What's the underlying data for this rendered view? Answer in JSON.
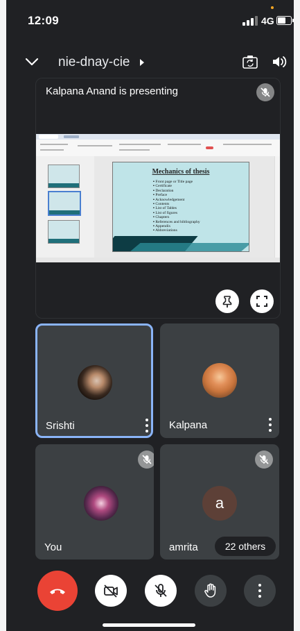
{
  "status_bar": {
    "time": "12:09",
    "network": "4G"
  },
  "top_bar": {
    "meeting_name": "nie-dnay-cie"
  },
  "presentation": {
    "label": "Kalpana Anand is presenting",
    "slide": {
      "title": "Mechanics of thesis",
      "bullets": [
        "Front page or Title page",
        "Certificate",
        "Declaration",
        "Preface",
        "Acknowledgement",
        "Contents",
        "List of Tables",
        "List of figures",
        "Chapters",
        "References and bibliography",
        "Appendix",
        "Abbreviations"
      ]
    }
  },
  "participants": [
    {
      "name": "Srishti",
      "muted": false,
      "active_speaker": true
    },
    {
      "name": "Kalpana",
      "muted": false
    },
    {
      "name": "You",
      "muted": true
    },
    {
      "name": "amrita",
      "muted": true,
      "avatar_letter": "a",
      "avatar_color": "#5d4037"
    }
  ],
  "others_label": "22 others",
  "colors": {
    "background": "#202124",
    "tile": "#3c4043",
    "end_call": "#ea4335",
    "active_border": "#8ab4f8"
  },
  "icons": {
    "top": [
      "chevron-down-icon",
      "play-arrow-icon",
      "camera-switch-icon",
      "speaker-icon"
    ],
    "tile": [
      "mic-off-icon",
      "pin-icon",
      "fullscreen-icon",
      "more-vert-icon"
    ],
    "controls": [
      "end-call-icon",
      "camera-off-icon",
      "mic-off-icon",
      "raise-hand-icon",
      "more-vert-icon"
    ]
  }
}
